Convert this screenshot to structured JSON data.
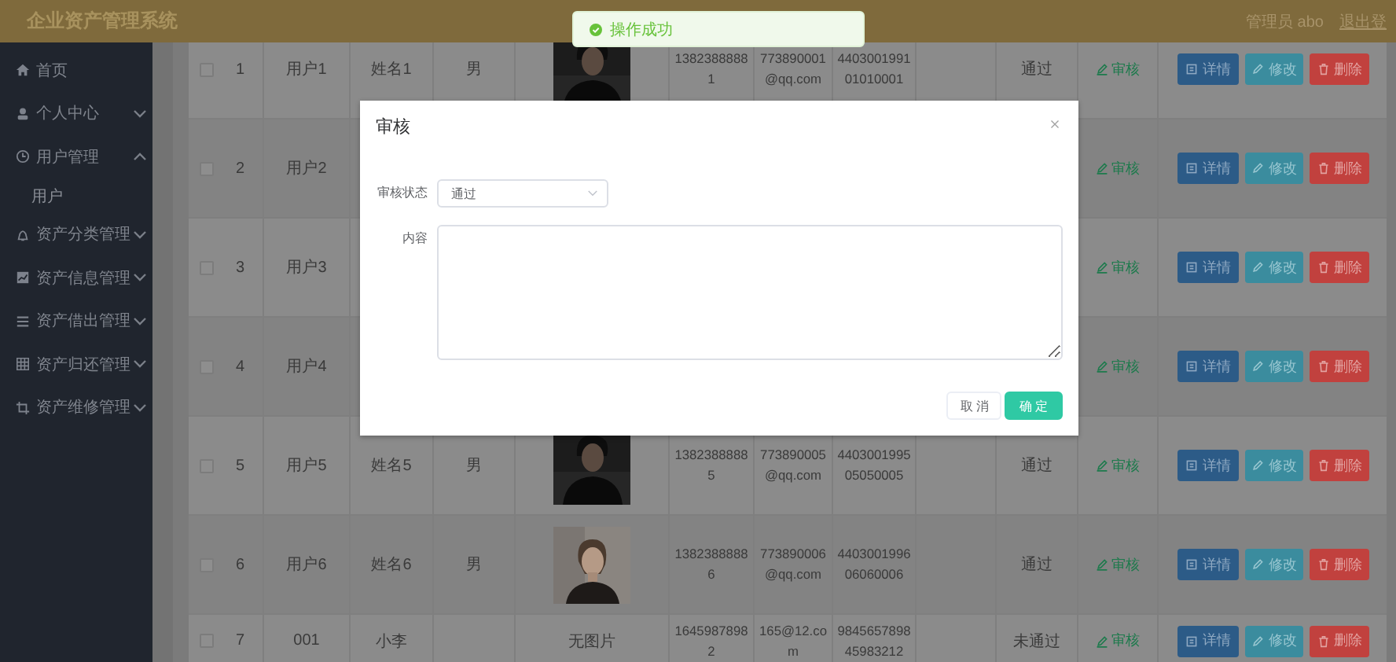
{
  "header": {
    "title": "企业资产管理系统",
    "user": "管理员 abo",
    "logout": "退出登"
  },
  "toast": {
    "message": "操作成功"
  },
  "sidebar": {
    "items": [
      {
        "label": "首页"
      },
      {
        "label": "个人中心",
        "expanded": false
      },
      {
        "label": "用户管理",
        "expanded": true,
        "children": [
          {
            "label": "用户"
          }
        ]
      },
      {
        "label": "资产分类管理",
        "expanded": false
      },
      {
        "label": "资产信息管理",
        "expanded": false
      },
      {
        "label": "资产借出管理",
        "expanded": false
      },
      {
        "label": "资产归还管理",
        "expanded": false
      },
      {
        "label": "资产维修管理",
        "expanded": false
      }
    ]
  },
  "table": {
    "rows": [
      {
        "checked": false,
        "index": "1",
        "username": "用户1",
        "name": "姓名1",
        "gender": "男",
        "phone": "13823888881",
        "email": "773890001@qq.com",
        "id_card": "440300199101010001",
        "status": "通过",
        "audit_link": "审核",
        "actions": [
          "详情",
          "修改",
          "删除"
        ]
      },
      {
        "checked": false,
        "index": "2",
        "username": "用户2",
        "audit_link": "审核",
        "actions": [
          "详情",
          "修改",
          "删除"
        ]
      },
      {
        "checked": false,
        "index": "3",
        "username": "用户3",
        "audit_link": "审核",
        "actions": [
          "详情",
          "修改",
          "删除"
        ]
      },
      {
        "checked": false,
        "index": "4",
        "username": "用户4",
        "audit_link": "审核",
        "actions": [
          "详情",
          "修改",
          "删除"
        ]
      },
      {
        "checked": false,
        "index": "5",
        "username": "用户5",
        "name": "姓名5",
        "gender": "男",
        "phone": "13823888885",
        "email": "773890005@qq.com",
        "id_card": "440300199505050005",
        "status": "通过",
        "audit_link": "审核",
        "actions": [
          "详情",
          "修改",
          "删除"
        ]
      },
      {
        "checked": false,
        "index": "6",
        "username": "用户6",
        "name": "姓名6",
        "gender": "男",
        "phone": "13823888886",
        "email": "773890006@qq.com",
        "id_card": "440300199606060006",
        "status": "通过",
        "audit_link": "审核",
        "actions": [
          "详情",
          "修改",
          "删除"
        ]
      },
      {
        "checked": false,
        "index": "7",
        "username": "001",
        "name": "小李",
        "photo_text": "无图片",
        "phone": "16459878982",
        "email": "165@12.com",
        "id_card": "984565789845983212",
        "status": "未通过",
        "audit_link": "审核",
        "actions": [
          "详情",
          "修改",
          "删除"
        ]
      }
    ]
  },
  "dialog": {
    "title": "审核",
    "fields": [
      {
        "kind": "select",
        "label": "审核状态",
        "value": "通过"
      },
      {
        "kind": "textarea",
        "label": "内容"
      }
    ],
    "buttons": [
      {
        "kind": "default",
        "label": "取 消"
      },
      {
        "kind": "primary",
        "label": "确 定"
      }
    ]
  }
}
